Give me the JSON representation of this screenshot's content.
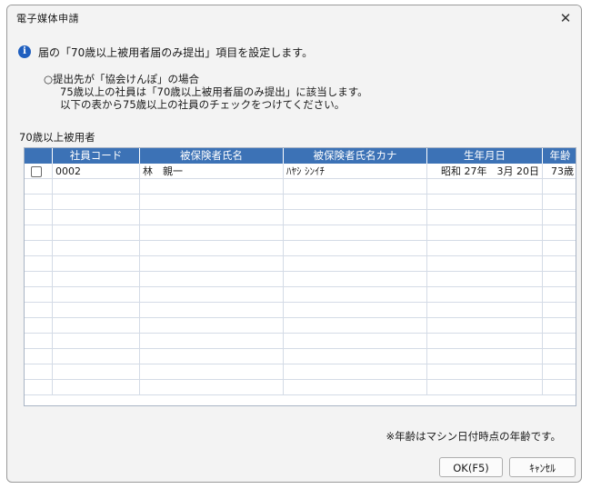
{
  "window": {
    "title": "電子媒体申請"
  },
  "info": {
    "message": "届の「70歳以上被用者届のみ提出」項目を設定します。"
  },
  "notes": [
    "○提出先が「協会けんぽ」の場合",
    "75歳以上の社員は「70歳以上被用者届のみ提出」に該当します。",
    "以下の表から75歳以上の社員のチェックをつけてください。"
  ],
  "section": {
    "label": "70歳以上被用者"
  },
  "table": {
    "columns": [
      "社員コード",
      "被保険者氏名",
      "被保険者氏名カナ",
      "生年月日",
      "年齢"
    ],
    "rows": [
      {
        "checked": false,
        "code": "0002",
        "name": "林　親一",
        "kana": "ﾊﾔｼ ｼﾝｲﾁ",
        "birth": "昭和 27年　3月 20日",
        "age": "73歳"
      }
    ]
  },
  "footnote": "※年齢はマシン日付時点の年齢です。",
  "buttons": {
    "ok": "OK(F5)",
    "cancel": "ｷｬﾝｾﾙ"
  },
  "icons": {
    "info": "info-icon",
    "close": "close-icon"
  }
}
